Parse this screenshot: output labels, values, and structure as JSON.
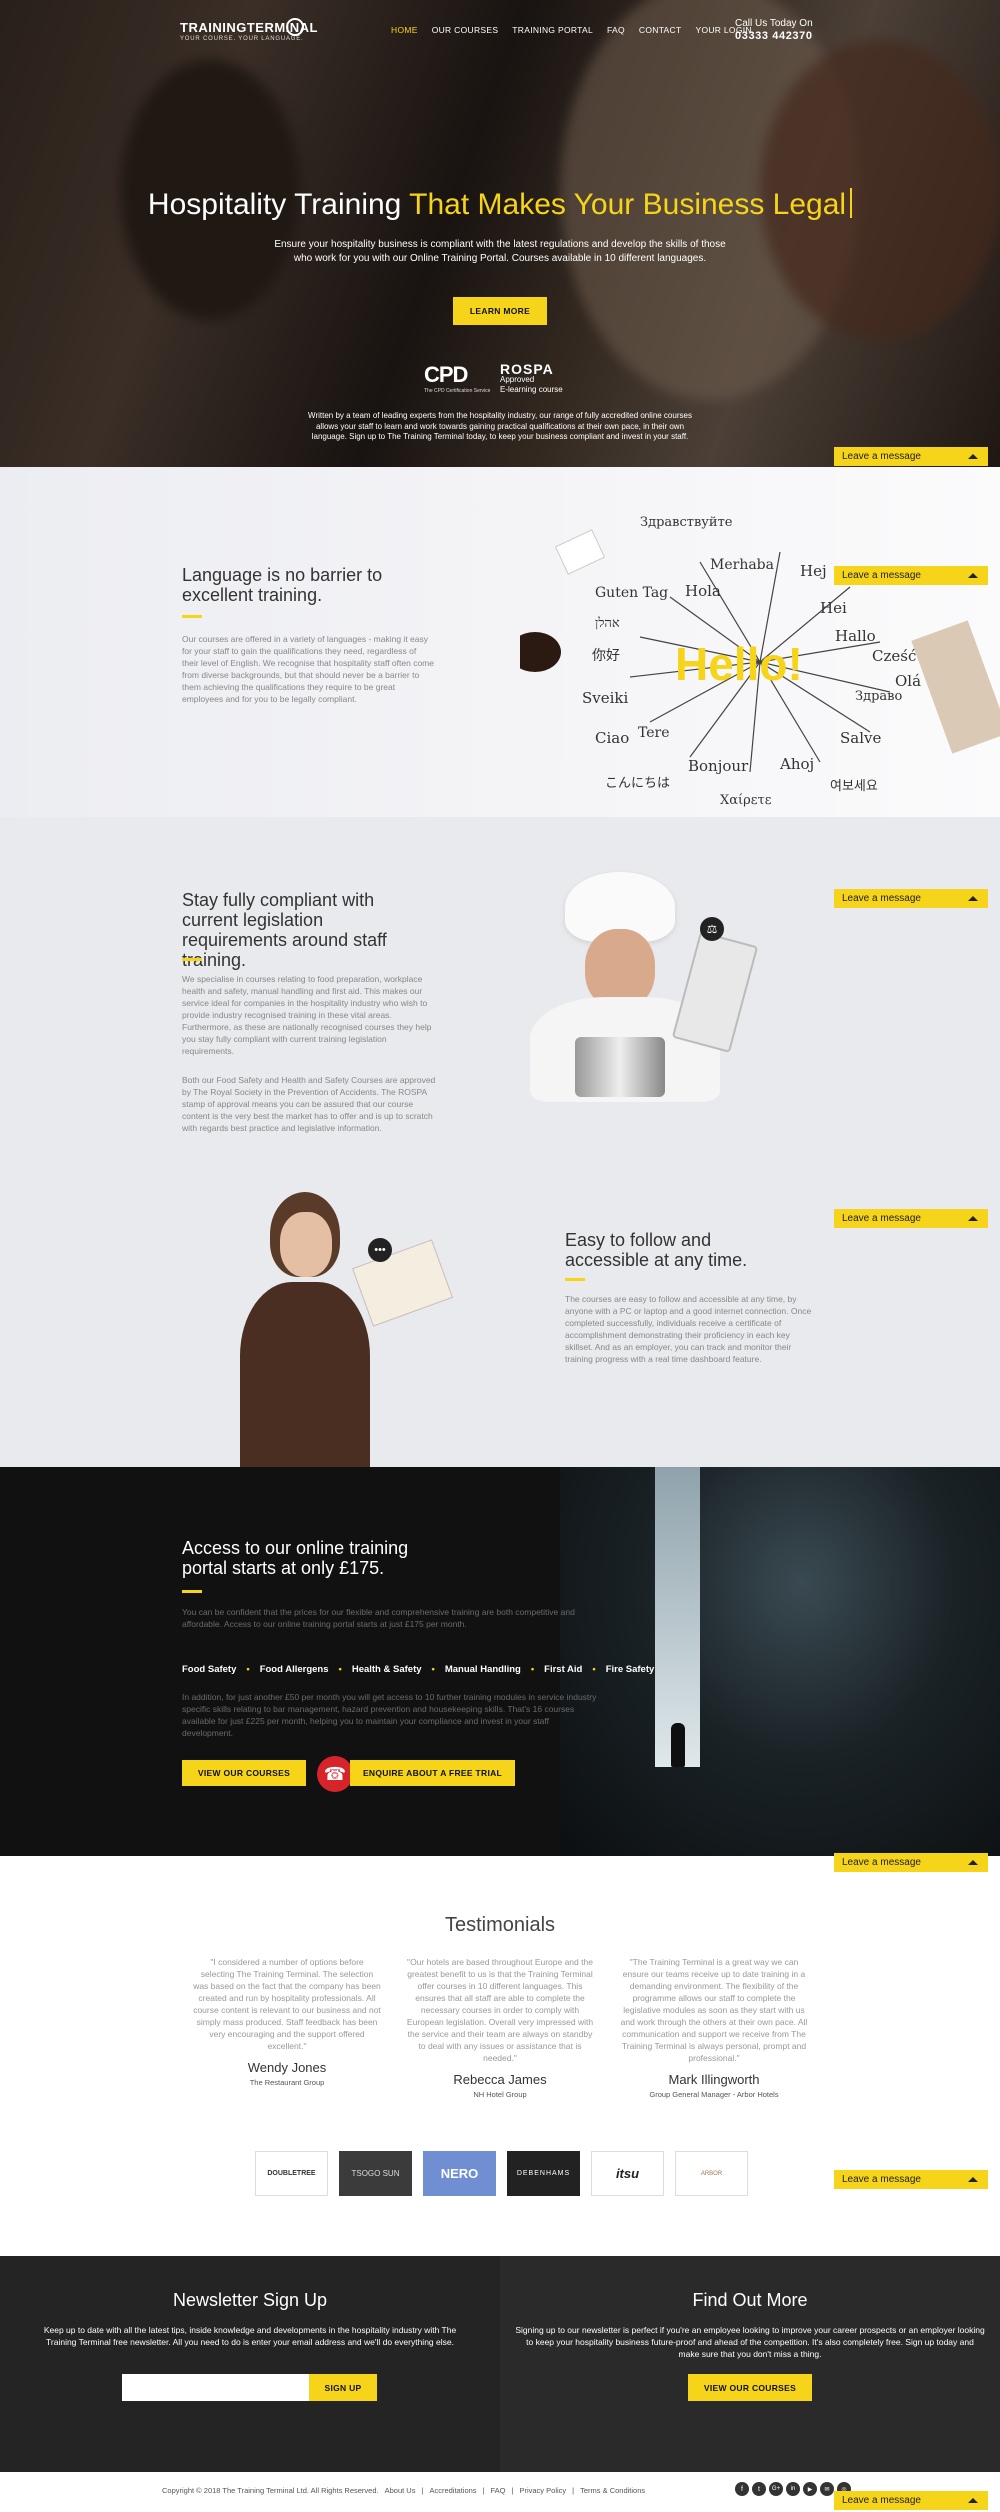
{
  "header": {
    "logo_main": "TRAININGTERMINAL",
    "logo_tagline": "YOUR COURSE. YOUR LANGUAGE.",
    "nav": [
      "HOME",
      "OUR COURSES",
      "TRAINING PORTAL",
      "FAQ",
      "CONTACT",
      "YOUR LOGIN"
    ],
    "call_label": "Call Us Today On",
    "phone": "03333 442370"
  },
  "hero": {
    "title_white": "Hospitality Training ",
    "title_yellow": "That Makes Your Business Legal",
    "subtitle": "Ensure your hospitality business is compliant with the latest regulations and develop the skills of those who work for you with our Online Training Portal. Courses available in 10 different languages.",
    "button": "LEARN MORE",
    "cpd_logo": "CPD",
    "cpd_small": "The CPD Certification Service",
    "rospa_logo": "ROSPA",
    "rospa_line1": "Approved",
    "rospa_line2": "E-learning course",
    "written": "Written by a team of leading experts from the hospitality industry, our range of fully accredited online courses allows your staff to learn and work towards gaining practical qualifications at their own pace, in their own language. Sign up to The Training Terminal today, to keep your business compliant and invest in your staff."
  },
  "leave_message": "Leave a message",
  "language": {
    "title": "Language is no barrier to excellent training.",
    "body": "Our courses are offered in a variety of languages - making it easy for your staff to gain the qualifications they need, regardless of their level of English. We recognise that hospitality staff often come from diverse backgrounds, but that should never be a barrier to them achieving the qualifications they require to be great employees and for you to be legally compliant.",
    "hello": "Hello!",
    "words": [
      "Здравствуйте",
      "Merhaba",
      "Hej",
      "Guten Tag",
      "Hola",
      "Hei",
      "אהלן",
      "Hallo",
      "Cześć",
      "你好",
      "Olá",
      "Sveiki",
      "Здраво",
      "Ciao",
      "Tere",
      "Salve",
      "Bonjour",
      "Ahoj",
      "こんにちは",
      "Χαίρετε",
      "여보세요"
    ]
  },
  "compliant": {
    "title": "Stay fully compliant with current legislation requirements around staff training.",
    "body1": "We specialise in courses relating to food preparation, workplace health and safety, manual handling and first aid. This makes our service ideal for companies in the hospitality industry who wish to provide industry recognised training in these vital areas. Furthermore, as these are nationally recognised courses they help you stay fully compliant with current training legislation requirements.",
    "body2": "Both our Food Safety and Health and Safety Courses are approved by The Royal Society in the Prevention of Accidents. The ROSPA stamp of approval means you can be assured that our course content is the very best the market has to offer and is up to scratch with regards best practice and legislative information."
  },
  "easy": {
    "title": "Easy to follow and accessible at any time.",
    "body": "The courses are easy to follow and accessible at any time, by anyone with a PC or laptop and a good internet connection. Once completed successfully, individuals receive a certificate of accomplishment demonstrating their proficiency in each key skillset. And as an employer, you can track and monitor their training progress with a real time dashboard feature."
  },
  "access": {
    "title": "Access to our online training portal starts at only £175.",
    "body1": "You can be confident that the prices for our flexible and comprehensive training are both competitive and affordable. Access to our online training portal starts at just £175 per month.",
    "courses": [
      "Food Safety",
      "Food Allergens",
      "Health & Safety",
      "Manual Handling",
      "First Aid",
      "Fire Safety"
    ],
    "body2": "In addition, for just another £50 per month you will get access to 10 further training modules in service industry specific skills relating to bar management, hazard prevention and housekeeping skills. That's 16 courses available for just £225 per month, helping you to maintain your compliance and invest in your staff development.",
    "btn1": "VIEW OUR COURSES",
    "btn2": "ENQUIRE ABOUT A FREE TRIAL"
  },
  "testimonials": {
    "title": "Testimonials",
    "items": [
      {
        "quote": "\"I considered a number of options before selecting The Training Terminal. The selection was based on the fact that the company has been created and run by hospitality professionals. All course content is relevant to our business and not simply mass produced. Staff feedback has been very encouraging and the support offered excellent.\"",
        "name": "Wendy Jones",
        "org": "The Restaurant Group"
      },
      {
        "quote": "\"Our hotels are based throughout Europe and the greatest benefit to us is that the Training Terminal offer courses in 10 different languages. This ensures that all staff are able to complete the necessary courses in order to comply with European legislation. Overall very impressed with the service and their team are always on standby to deal with any issues or assistance that is needed.\"",
        "name": "Rebecca James",
        "org": "NH Hotel Group"
      },
      {
        "quote": "\"The Training Terminal is a great way we can ensure our teams receive up to date training in a demanding environment. The flexibility of the programme allows our staff to complete the legislative modules as soon as they start with us and work through the others at their own pace. All communication and support we receive from The Training Terminal is always personal, prompt and professional.\"",
        "name": "Mark Illingworth",
        "org": "Group General Manager - Arbor Hotels"
      }
    ],
    "logos": [
      "DOUBLETREE",
      "TSOGO SUN",
      "NERO",
      "DEBENHAMS",
      "itsu",
      "ARBOR"
    ]
  },
  "newsletter": {
    "title": "Newsletter Sign Up",
    "body": "Keep up to date with all the latest tips, inside knowledge and developments in the hospitality industry with The Training Terminal free newsletter. All you need to do is enter your email address and we'll do everything else.",
    "button": "SIGN UP",
    "input_value": ""
  },
  "findout": {
    "title": "Find Out More",
    "body": "Signing up to our newsletter is perfect if you're an employee looking to improve your career prospects or an employer looking to keep your hospitality business future-proof and ahead of the competition. It's also completely free. Sign up today and make sure that you don't miss a thing.",
    "button": "VIEW OUR COURSES"
  },
  "footer": {
    "copyright": "Copyright © 2018 The Training Terminal Ltd. All Rights Reserved.",
    "links": [
      "About Us",
      "Accreditations",
      "FAQ",
      "Privacy Policy",
      "Terms & Conditions"
    ],
    "social": [
      "f",
      "t",
      "G+",
      "in",
      "▶",
      "✉",
      "◎"
    ]
  },
  "colors": {
    "accent": "#f6d419",
    "dark": "#242424",
    "footer_text": "#555"
  }
}
